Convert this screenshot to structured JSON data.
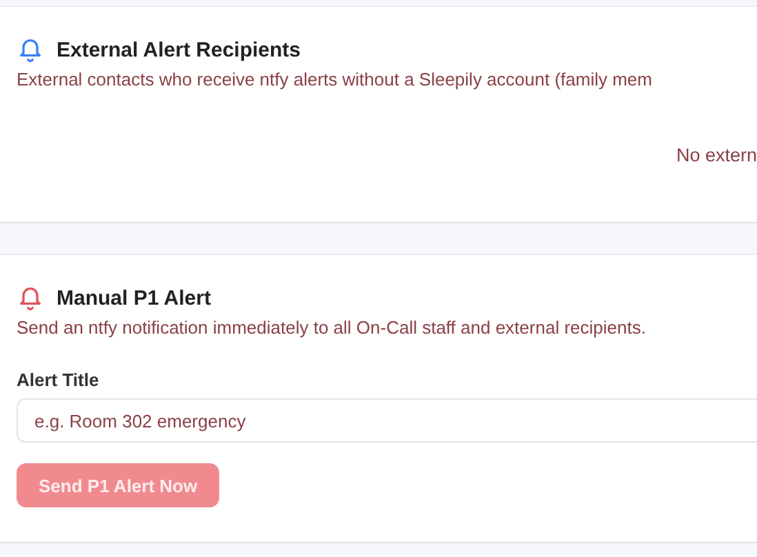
{
  "recipients": {
    "title": "External Alert Recipients",
    "kind": "info",
    "description": "External contacts who receive ntfy alerts without a Sleepily account (family mem",
    "empty_message": "No extern"
  },
  "manual_alert": {
    "title": "Manual P1 Alert",
    "kind": "danger",
    "description": "Send an ntfy notification immediately to all On-Call staff and external recipients.",
    "field_label": "Alert Title",
    "placeholder": "e.g. Room 302 emergency",
    "button": {
      "label": "Send P1 Alert Now",
      "disabled": true
    }
  }
}
